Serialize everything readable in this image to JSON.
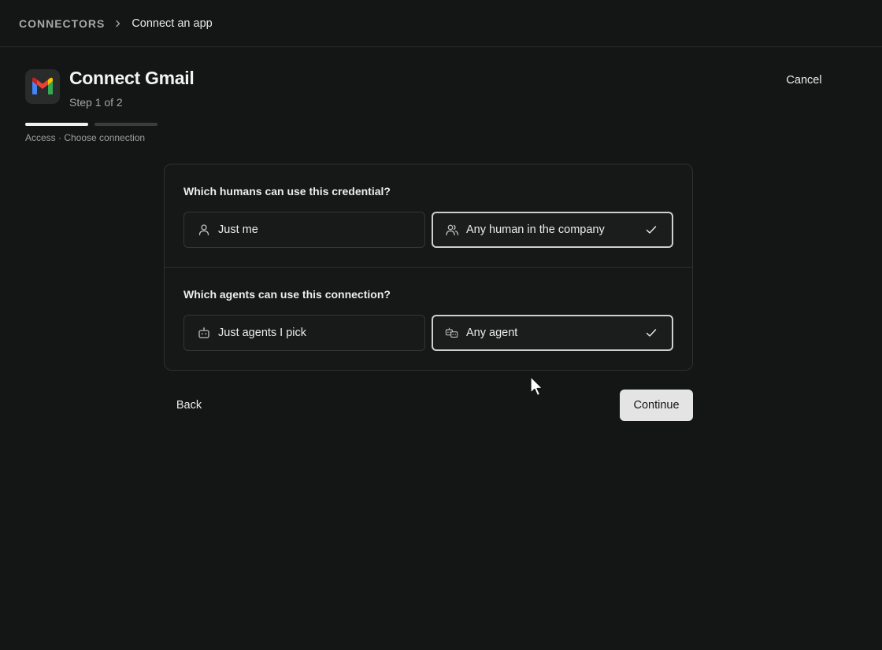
{
  "breadcrumb": {
    "root": "CONNECTORS",
    "current": "Connect an app"
  },
  "header": {
    "title": "Connect Gmail",
    "step": "Step 1 of 2",
    "cancel_label": "Cancel"
  },
  "progress": {
    "steps_total": 2,
    "steps_active": 1,
    "caption": "Access · Choose connection"
  },
  "humans": {
    "question": "Which humans can use this credential?",
    "options": [
      {
        "label": "Just me",
        "icon": "person-icon",
        "selected": false
      },
      {
        "label": "Any human in the company",
        "icon": "people-icon",
        "selected": true
      }
    ]
  },
  "agents": {
    "question": "Which agents can use this connection?",
    "options": [
      {
        "label": "Just agents I pick",
        "icon": "robot-icon",
        "selected": false
      },
      {
        "label": "Any agent",
        "icon": "robots-icon",
        "selected": true
      }
    ]
  },
  "footer": {
    "back_label": "Back",
    "continue_label": "Continue"
  },
  "colors": {
    "background": "#141515",
    "accent": "#e4e4e4",
    "border": "#2f3030"
  }
}
